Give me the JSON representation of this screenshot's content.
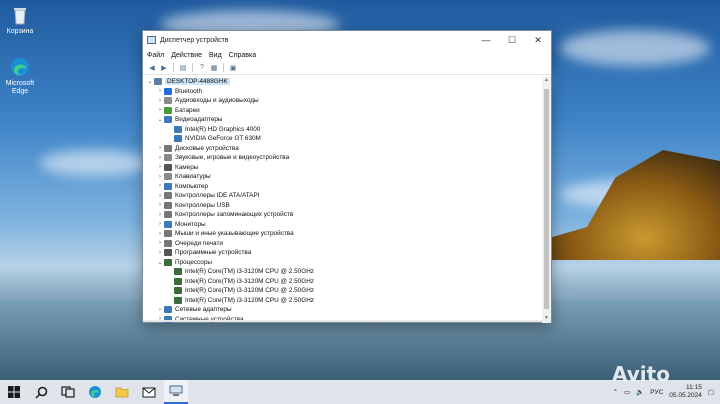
{
  "desktop": {
    "icons": [
      {
        "name": "recycle-bin",
        "label": "Корзина"
      },
      {
        "name": "edge",
        "label": "Microsoft Edge"
      }
    ]
  },
  "window": {
    "title": "Диспетчер устройств",
    "controls": [
      "—",
      "☐",
      "✕"
    ],
    "menu": [
      "Файл",
      "Действие",
      "Вид",
      "Справка"
    ],
    "tree": [
      {
        "level": 0,
        "exp": "⌄",
        "label": "DESKTOP-4488GHK",
        "icon": "computer",
        "color": "#5a7fa8"
      },
      {
        "level": 1,
        "exp": "›",
        "label": "Bluetooth",
        "icon": "bluetooth",
        "color": "#1e6fd9"
      },
      {
        "level": 1,
        "exp": "›",
        "label": "Аудиовходы и аудиовыходы",
        "icon": "speaker",
        "color": "#8a8a8a"
      },
      {
        "level": 1,
        "exp": "›",
        "label": "Батареи",
        "icon": "battery",
        "color": "#4a9a3a"
      },
      {
        "level": 1,
        "exp": "⌄",
        "label": "Видеоадаптеры",
        "icon": "display-adapter",
        "color": "#3a7ab8"
      },
      {
        "level": 2,
        "exp": "",
        "label": "Intel(R) HD Graphics 4000",
        "icon": "display-adapter",
        "color": "#3a7ab8"
      },
      {
        "level": 2,
        "exp": "",
        "label": "NVIDIA GeForce GT 630M",
        "icon": "display-adapter",
        "color": "#3a7ab8"
      },
      {
        "level": 1,
        "exp": "›",
        "label": "Дисковые устройства",
        "icon": "disk",
        "color": "#777"
      },
      {
        "level": 1,
        "exp": "›",
        "label": "Звуковые, игровые и видеоустройства",
        "icon": "speaker",
        "color": "#8a8a8a"
      },
      {
        "level": 1,
        "exp": "›",
        "label": "Камеры",
        "icon": "camera",
        "color": "#555"
      },
      {
        "level": 1,
        "exp": "›",
        "label": "Клавиатуры",
        "icon": "keyboard",
        "color": "#8a8a8a"
      },
      {
        "level": 1,
        "exp": "›",
        "label": "Компьютер",
        "icon": "monitor",
        "color": "#3a7ab8"
      },
      {
        "level": 1,
        "exp": "›",
        "label": "Контроллеры IDE ATA/ATAPI",
        "icon": "controller",
        "color": "#777"
      },
      {
        "level": 1,
        "exp": "›",
        "label": "Контроллеры USB",
        "icon": "usb",
        "color": "#777"
      },
      {
        "level": 1,
        "exp": "›",
        "label": "Контроллеры запоминающих устройств",
        "icon": "controller",
        "color": "#777"
      },
      {
        "level": 1,
        "exp": "›",
        "label": "Мониторы",
        "icon": "monitor",
        "color": "#3a7ab8"
      },
      {
        "level": 1,
        "exp": "›",
        "label": "Мыши и иные указывающие устройства",
        "icon": "mouse",
        "color": "#777"
      },
      {
        "level": 1,
        "exp": "›",
        "label": "Очереди печати",
        "icon": "printer",
        "color": "#777"
      },
      {
        "level": 1,
        "exp": "›",
        "label": "Программные устройства",
        "icon": "software-device",
        "color": "#555"
      },
      {
        "level": 1,
        "exp": "⌄",
        "label": "Процессоры",
        "icon": "cpu",
        "color": "#3b6a3b"
      },
      {
        "level": 2,
        "exp": "",
        "label": "Intel(R) Core(TM) i3-3120M CPU @ 2.50GHz",
        "icon": "cpu",
        "color": "#3b6a3b"
      },
      {
        "level": 2,
        "exp": "",
        "label": "Intel(R) Core(TM) i3-3120M CPU @ 2.50GHz",
        "icon": "cpu",
        "color": "#3b6a3b"
      },
      {
        "level": 2,
        "exp": "",
        "label": "Intel(R) Core(TM) i3-3120M CPU @ 2.50GHz",
        "icon": "cpu",
        "color": "#3b6a3b"
      },
      {
        "level": 2,
        "exp": "",
        "label": "Intel(R) Core(TM) i3-3120M CPU @ 2.50GHz",
        "icon": "cpu",
        "color": "#3b6a3b"
      },
      {
        "level": 1,
        "exp": "›",
        "label": "Сетевые адаптеры",
        "icon": "network",
        "color": "#3a7ab8"
      },
      {
        "level": 1,
        "exp": "›",
        "label": "Системные устройства",
        "icon": "system-device",
        "color": "#3a7ab8"
      }
    ]
  },
  "taskbar": {
    "lang": "РУС",
    "time": "11:15",
    "date": "05.05.2024"
  },
  "watermark": "Avito"
}
